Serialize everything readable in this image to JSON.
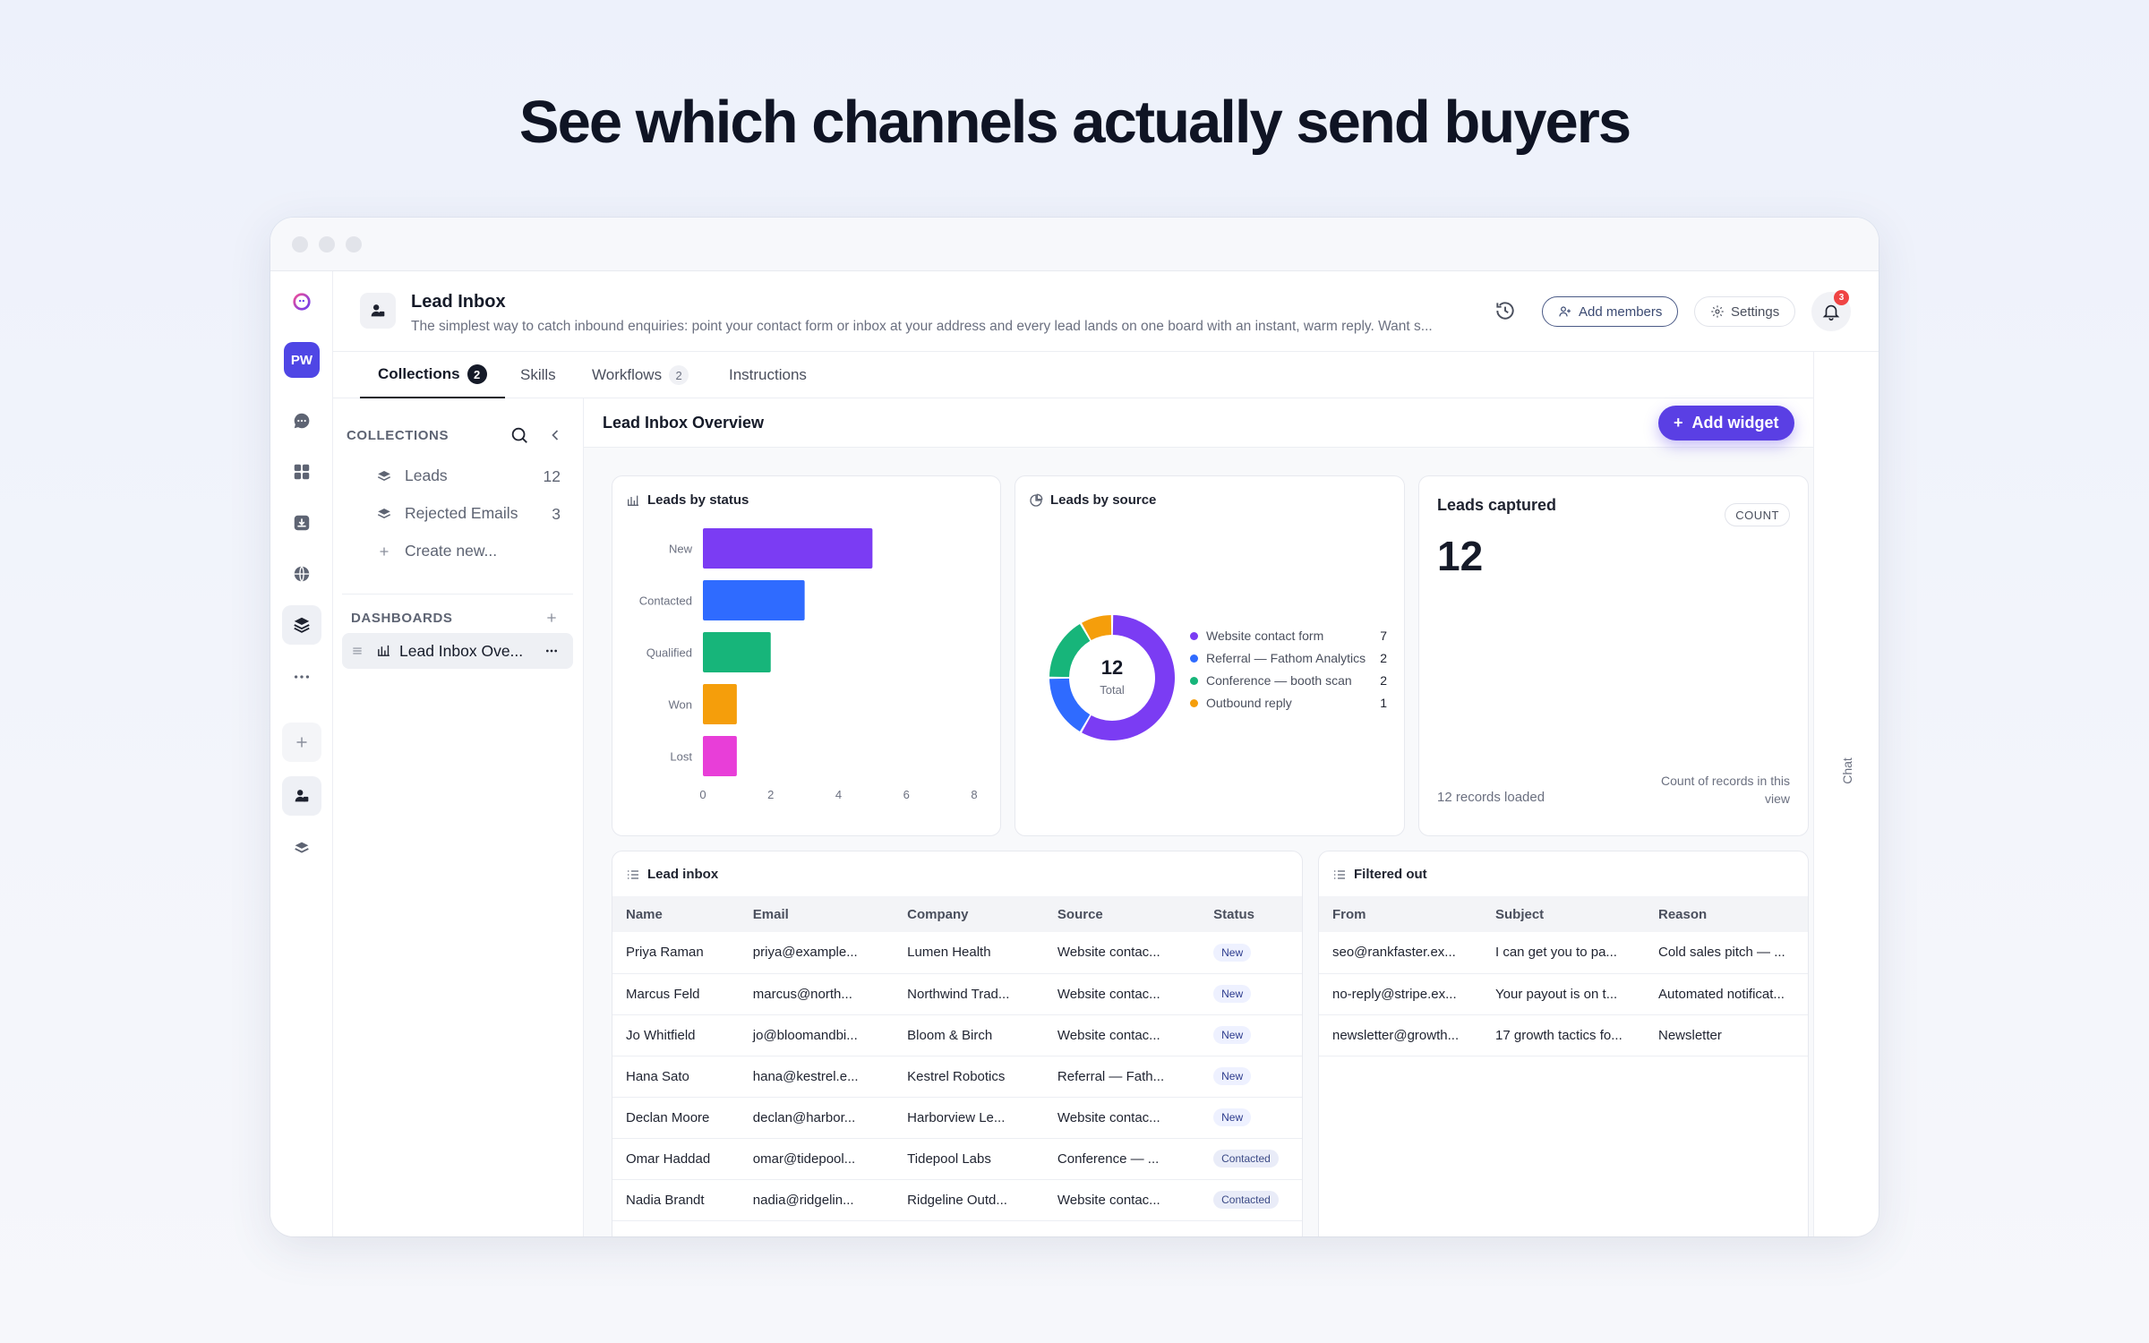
{
  "headline": "See which channels actually send buyers",
  "rail": {
    "workspace_initials": "PW"
  },
  "header": {
    "title": "Lead Inbox",
    "description": "The simplest way to catch inbound enquiries: point your contact form or inbox at your address and every lead lands on one board with an instant, warm reply. Want s...",
    "add_members_label": "Add members",
    "settings_label": "Settings",
    "notification_count": "3"
  },
  "tabs": [
    {
      "label": "Collections",
      "count": "2"
    },
    {
      "label": "Skills",
      "count": ""
    },
    {
      "label": "Workflows",
      "count": "2"
    },
    {
      "label": "Instructions",
      "count": ""
    }
  ],
  "chat_label": "Chat",
  "sidebar": {
    "collections_heading": "COLLECTIONS",
    "collections": [
      {
        "label": "Leads",
        "count": "12"
      },
      {
        "label": "Rejected Emails",
        "count": "3"
      }
    ],
    "create_new": "Create new...",
    "dashboards_heading": "DASHBOARDS",
    "dashboard_item": "Lead Inbox Ove..."
  },
  "content": {
    "title": "Lead Inbox Overview",
    "add_widget_label": "Add widget"
  },
  "widgets": {
    "status_title": "Leads by status",
    "source_title": "Leads by source",
    "donut_total": "12",
    "donut_total_label": "Total",
    "kpi_title": "Leads captured",
    "kpi_badge": "COUNT",
    "kpi_value": "12",
    "kpi_footer_left": "12 records loaded",
    "kpi_footer_right": "Count of records in this view"
  },
  "chart_data": [
    {
      "type": "bar",
      "orientation": "horizontal",
      "title": "Leads by status",
      "categories": [
        "New",
        "Contacted",
        "Qualified",
        "Won",
        "Lost"
      ],
      "values": [
        5,
        3,
        2,
        1,
        1
      ],
      "colors": [
        "#7b3cf3",
        "#2f6bff",
        "#17b57a",
        "#f59e0b",
        "#e83ed8"
      ],
      "xlim": [
        0,
        8
      ],
      "xticks": [
        "0",
        "2",
        "4",
        "6",
        "8"
      ]
    },
    {
      "type": "pie",
      "donut": true,
      "title": "Leads by source",
      "categories": [
        "Website contact form",
        "Referral — Fathom Analytics",
        "Conference — booth scan",
        "Outbound reply"
      ],
      "values": [
        7,
        2,
        2,
        1
      ],
      "colors": [
        "#7b3cf3",
        "#2f6bff",
        "#17b57a",
        "#f59e0b"
      ],
      "legend": "right"
    }
  ],
  "lead_inbox": {
    "title": "Lead inbox",
    "columns": [
      "Name",
      "Email",
      "Company",
      "Source",
      "Status"
    ],
    "rows": [
      [
        "Priya Raman",
        "priya@example...",
        "Lumen Health",
        "Website contac...",
        "New"
      ],
      [
        "Marcus Feld",
        "marcus@north...",
        "Northwind Trad...",
        "Website contac...",
        "New"
      ],
      [
        "Jo Whitfield",
        "jo@bloomandbi...",
        "Bloom & Birch",
        "Website contac...",
        "New"
      ],
      [
        "Hana Sato",
        "hana@kestrel.e...",
        "Kestrel Robotics",
        "Referral — Fath...",
        "New"
      ],
      [
        "Declan Moore",
        "declan@harbor...",
        "Harborview Le...",
        "Website contac...",
        "New"
      ],
      [
        "Omar Haddad",
        "omar@tidepool...",
        "Tidepool Labs",
        "Conference — ...",
        "Contacted"
      ],
      [
        "Nadia Brandt",
        "nadia@ridgelin...",
        "Ridgeline Outd...",
        "Website contac...",
        "Contacted"
      ]
    ]
  },
  "filtered_out": {
    "title": "Filtered out",
    "columns": [
      "From",
      "Subject",
      "Reason"
    ],
    "rows": [
      [
        "seo@rankfaster.ex...",
        "I can get you to pa...",
        "Cold sales pitch — ..."
      ],
      [
        "no-reply@stripe.ex...",
        "Your payout is on t...",
        "Automated notificat..."
      ],
      [
        "newsletter@growth...",
        "17 growth tactics fo...",
        "Newsletter"
      ]
    ]
  }
}
